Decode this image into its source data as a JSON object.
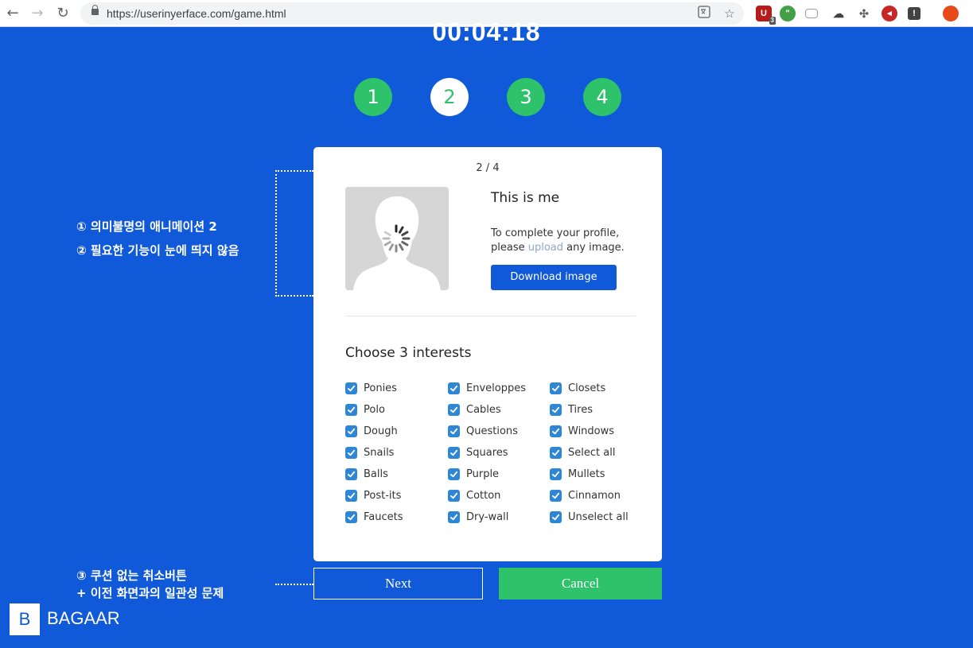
{
  "browser": {
    "url": "https://userinyerface.com/game.html",
    "back_glyph": "←",
    "forward_glyph": "→",
    "reload_glyph": "↻",
    "extension_badge": "3",
    "colors": {
      "shield": "#b71c1c",
      "chat": "#43a047",
      "avatar": "#e64a19"
    }
  },
  "game": {
    "timer": "00:04:18",
    "steps": [
      "1",
      "2",
      "3",
      "4"
    ],
    "active_step": "2"
  },
  "card": {
    "page_count": "2 / 4",
    "profile_title": "This is me",
    "profile_text_1": "To complete your profile,",
    "profile_text_2a": "please ",
    "upload_link": "upload",
    "profile_text_2b": " any image.",
    "download_button": "Download image",
    "interests_title": "Choose 3 interests",
    "interests": [
      [
        "Ponies",
        "Polo",
        "Dough",
        "Snails",
        "Balls",
        "Post-its",
        "Faucets"
      ],
      [
        "Enveloppes",
        "Cables",
        "Questions",
        "Squares",
        "Purple",
        "Cotton",
        "Dry-wall"
      ],
      [
        "Closets",
        "Tires",
        "Windows",
        "Select all",
        "Mullets",
        "Cinnamon",
        "Unselect all"
      ]
    ]
  },
  "buttons": {
    "next": "Next",
    "cancel": "Cancel"
  },
  "annotations": {
    "note1": "① 의미불명의 애니메이션 2",
    "note2": "② 필요한 기능이 눈에 띄지 않음",
    "note3": "③ 쿠션 없는 취소버튼",
    "note4": "+ 이전 화면과의 일관성 문제"
  },
  "logo": {
    "mark": "B",
    "name": "BAGAAR"
  },
  "colors": {
    "background": "#1059d8",
    "green": "#2ec26a",
    "checkbox": "#2e86d6",
    "link": "#8fa7c9"
  }
}
